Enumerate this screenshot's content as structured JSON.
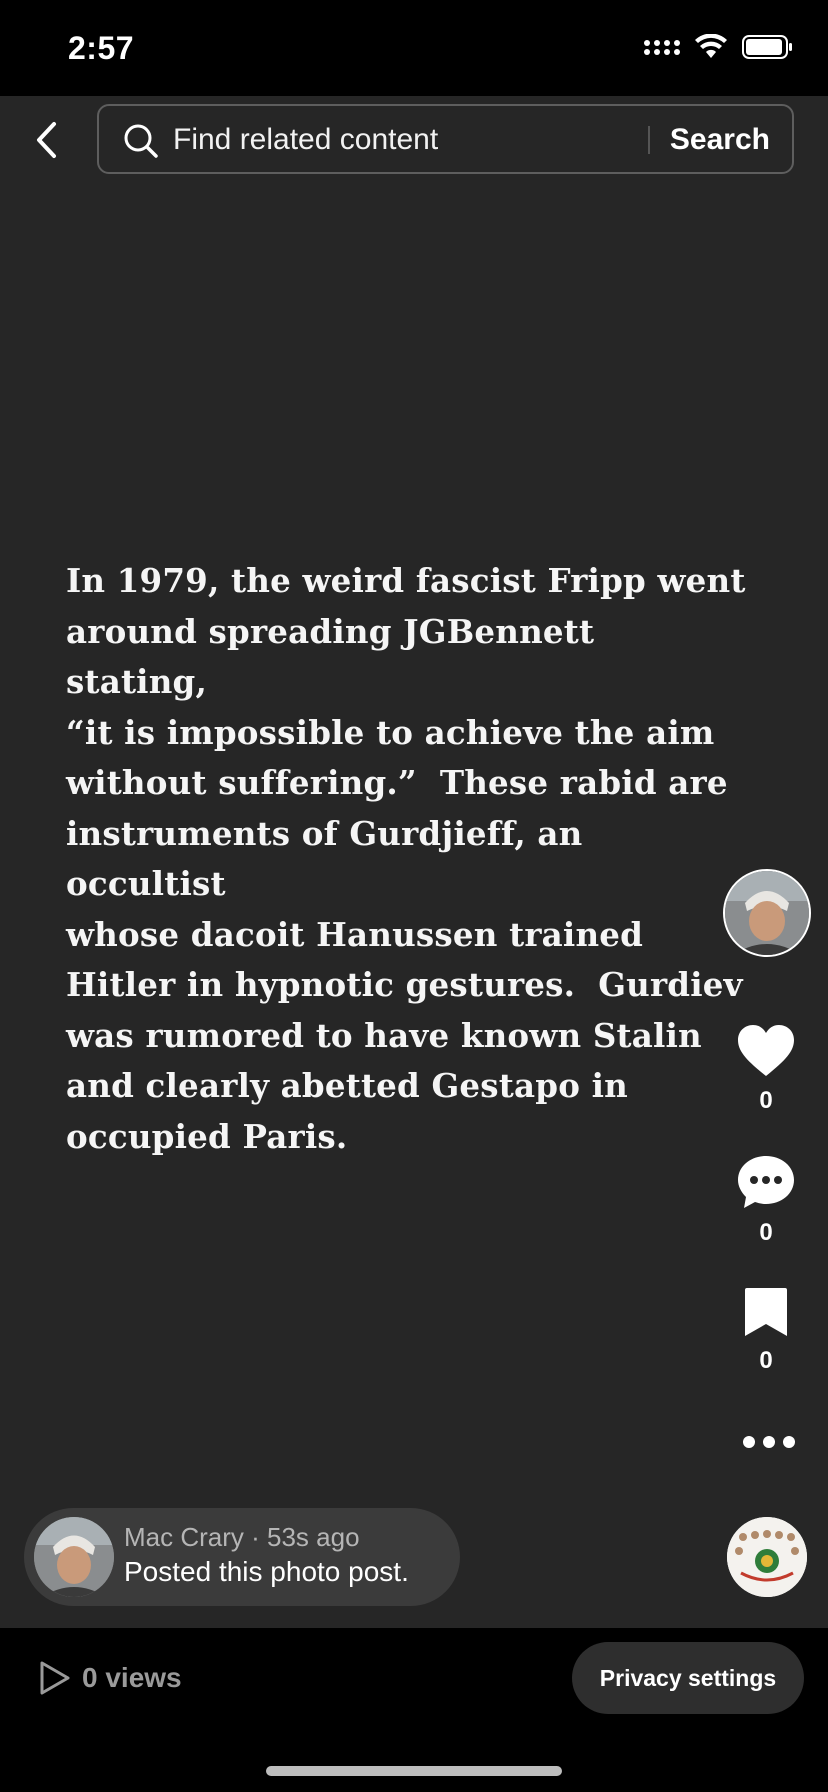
{
  "status_bar": {
    "time": "2:57"
  },
  "header": {
    "search_placeholder": "Find related content",
    "search_button": "Search"
  },
  "post": {
    "text_lines": [
      "In 1979, the weird fascist Fripp went",
      "around spreading JGBennett stating,",
      "“it is impossible to achieve the aim",
      "without suffering.”  These rabid are",
      "instruments of Gurdjieff, an occultist",
      "whose dacoit Hanussen trained",
      "Hitler in hypnotic gestures.  Gurdiev",
      "was rumored to have known Stalin",
      "and clearly abetted Gestapo in",
      "occupied Paris."
    ]
  },
  "actions": {
    "likes": "0",
    "comments": "0",
    "saves": "0"
  },
  "author": {
    "meta": "Mac Crary · 53s ago",
    "caption": "Posted this photo post."
  },
  "footer": {
    "views": "0 views",
    "privacy_button": "Privacy settings"
  },
  "colors": {
    "background": "#262626",
    "pill": "#3b3b3b",
    "text": "#ffffff"
  }
}
